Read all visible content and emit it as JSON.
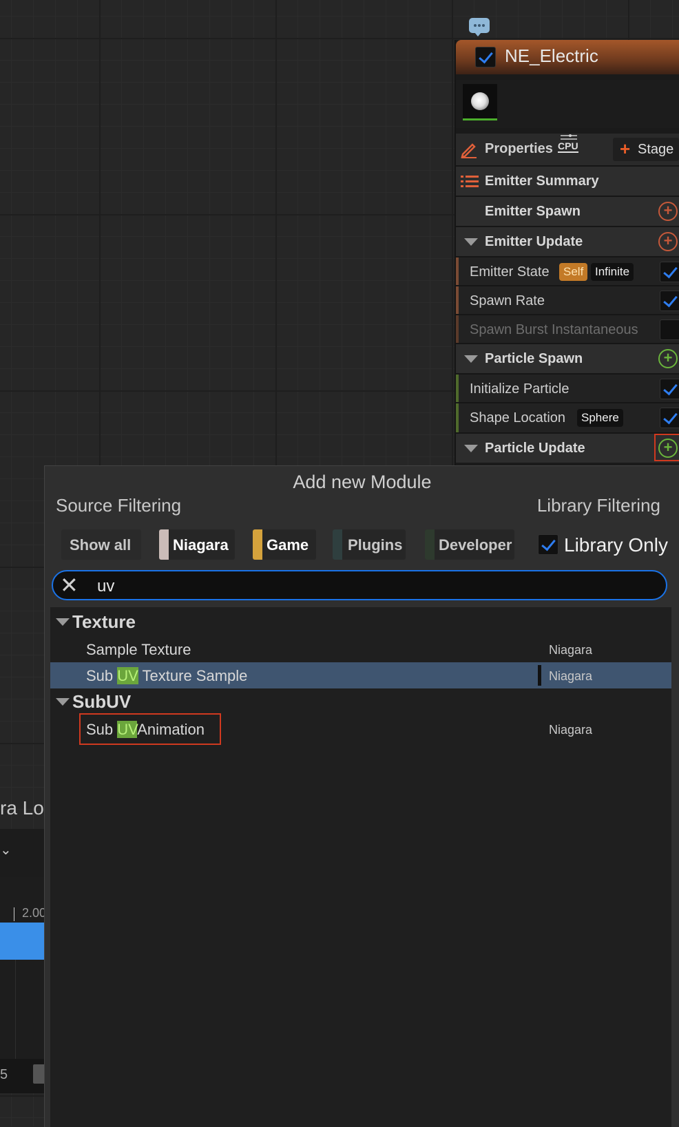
{
  "emitter": {
    "title": "NE_Electric",
    "properties_label": "Properties",
    "cpu_label": "CPU",
    "stage_label": "Stage",
    "stage_plus": "+",
    "summary_label": "Emitter Summary",
    "emitter_spawn_label": "Emitter Spawn",
    "emitter_update_label": "Emitter Update",
    "emitter_state_label": "Emitter State",
    "emitter_state_badge1": "Self",
    "emitter_state_badge2": "Infinite",
    "spawn_rate_label": "Spawn Rate",
    "spawn_burst_label": "Spawn Burst Instantaneous",
    "particle_spawn_label": "Particle Spawn",
    "initialize_particle_label": "Initialize Particle",
    "shape_location_label": "Shape Location",
    "shape_location_badge": "Sphere",
    "particle_update_label": "Particle Update",
    "add_symbol": "+",
    "colors": {
      "emitter_accent": "#c4583a",
      "particle_accent": "#6ab43c",
      "check_blue": "#2e7df0"
    }
  },
  "popup": {
    "title": "Add new Module",
    "source_filtering": "Source Filtering",
    "library_filtering": "Library Filtering",
    "filters": {
      "show_all": "Show all",
      "niagara": "Niagara",
      "game": "Game",
      "plugins": "Plugins",
      "developer": "Developer"
    },
    "library_only": "Library Only",
    "search": {
      "clear_symbol": "✕",
      "value": "uv"
    },
    "categories": [
      {
        "name": "Texture",
        "items": [
          {
            "pre": "Sample Texture",
            "match": "",
            "post": "",
            "source": "Niagara"
          },
          {
            "pre": "Sub ",
            "match": "UV",
            "post": " Texture Sample",
            "source": "Niagara",
            "selected": true
          }
        ]
      },
      {
        "name": "SubUV",
        "items": [
          {
            "pre": "Sub ",
            "match": "UV",
            "post": "Animation",
            "source": "Niagara"
          }
        ]
      }
    ]
  },
  "background_panel": {
    "title_fragment": "ra Log",
    "chevron": "⌄",
    "timeline_value": "2.00",
    "bottom_value": "5"
  }
}
